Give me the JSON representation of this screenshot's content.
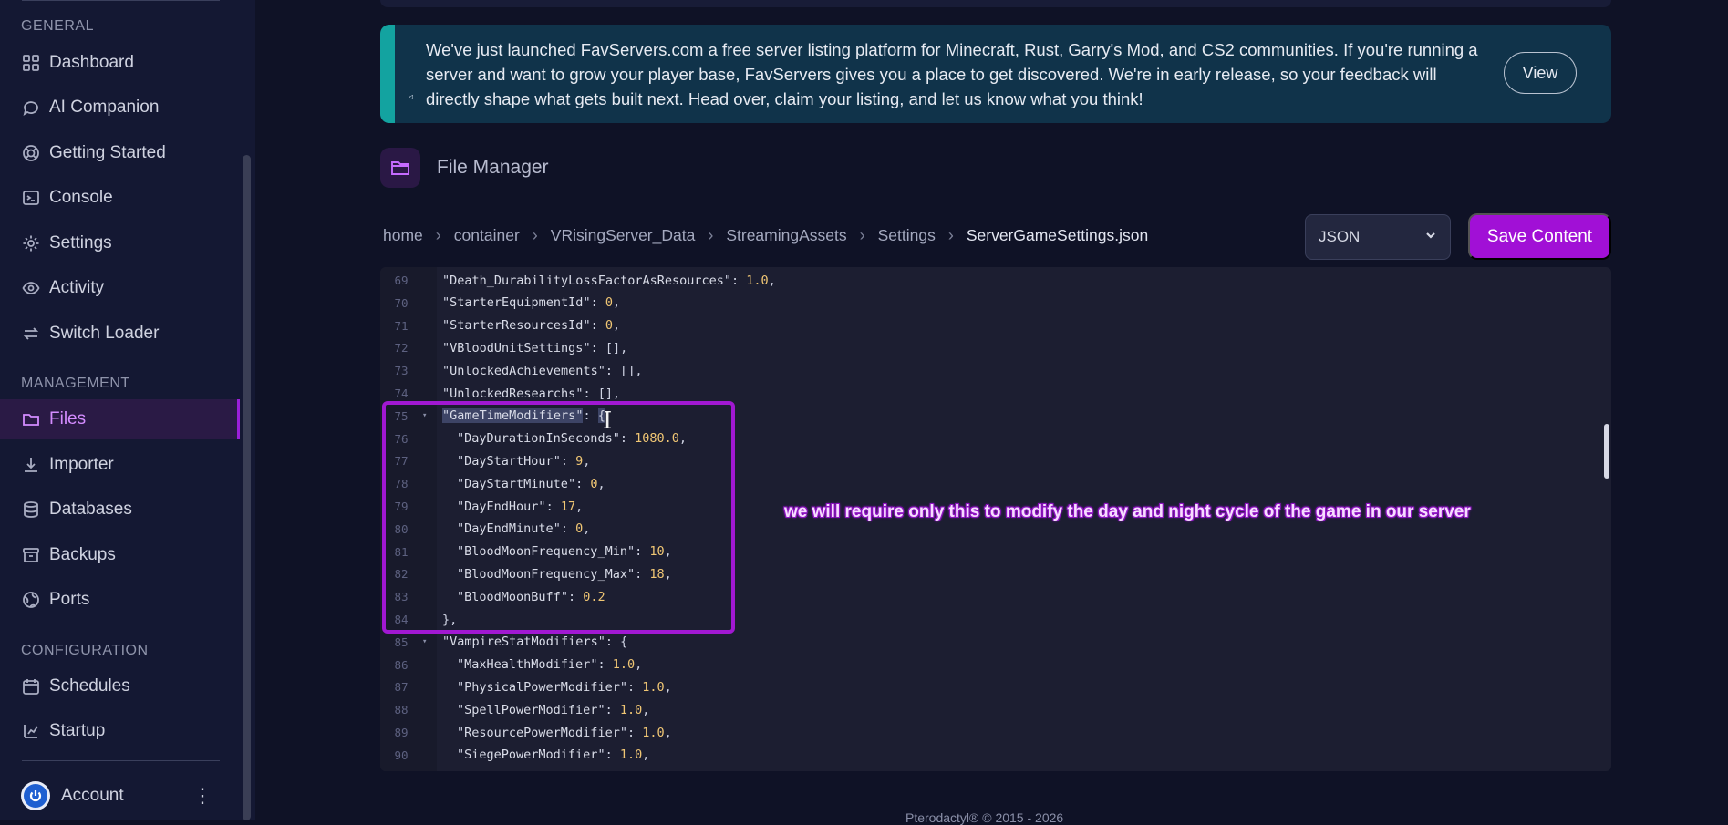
{
  "sidebar": {
    "sections": [
      {
        "label": "GENERAL",
        "items": [
          {
            "label": "Dashboard",
            "icon": "dashboard-icon"
          },
          {
            "label": "AI Companion",
            "icon": "chat-icon"
          },
          {
            "label": "Getting Started",
            "icon": "lifebuoy-icon"
          },
          {
            "label": "Console",
            "icon": "terminal-icon"
          },
          {
            "label": "Settings",
            "icon": "gear-icon"
          },
          {
            "label": "Activity",
            "icon": "eye-icon"
          },
          {
            "label": "Switch Loader",
            "icon": "swap-icon"
          }
        ]
      },
      {
        "label": "MANAGEMENT",
        "items": [
          {
            "label": "Files",
            "icon": "folder-icon",
            "active": true
          },
          {
            "label": "Importer",
            "icon": "download-icon"
          },
          {
            "label": "Databases",
            "icon": "database-icon"
          },
          {
            "label": "Backups",
            "icon": "archive-icon"
          },
          {
            "label": "Ports",
            "icon": "globe-icon"
          }
        ]
      },
      {
        "label": "CONFIGURATION",
        "items": [
          {
            "label": "Schedules",
            "icon": "calendar-icon"
          },
          {
            "label": "Startup",
            "icon": "startup-icon"
          }
        ]
      }
    ],
    "account": {
      "label": "Account"
    }
  },
  "banner": {
    "text": "We've just launched FavServers.com a free server listing platform for Minecraft, Rust, Garry's Mod, and CS2 communities. If you're running a server and want to grow your player base, FavServers gives you a place to get discovered. We're in early release, so your feedback will directly shape what gets built next. Head over, claim your listing, and let us know what you think!",
    "button": "View"
  },
  "file_manager": {
    "title": "File Manager",
    "breadcrumb": [
      "home",
      "container",
      "VRisingServer_Data",
      "StreamingAssets",
      "Settings",
      "ServerGameSettings.json"
    ],
    "mode": "JSON",
    "save_label": "Save Content"
  },
  "editor": {
    "lines": [
      {
        "n": "69",
        "indent": 1,
        "key": "Death_DurabilityLossFactorAsResources",
        "val": "1.0",
        "tail": ","
      },
      {
        "n": "70",
        "indent": 1,
        "key": "StarterEquipmentId",
        "val": "0",
        "tail": ","
      },
      {
        "n": "71",
        "indent": 1,
        "key": "StarterResourcesId",
        "val": "0",
        "tail": ","
      },
      {
        "n": "72",
        "indent": 1,
        "key": "VBloodUnitSettings",
        "val": "",
        "tail": "[],"
      },
      {
        "n": "73",
        "indent": 1,
        "key": "UnlockedAchievements",
        "val": "",
        "tail": "[],"
      },
      {
        "n": "74",
        "indent": 1,
        "key": "UnlockedResearchs",
        "val": "",
        "tail": "[],"
      },
      {
        "n": "75",
        "indent": 1,
        "key": "GameTimeModifiers",
        "val": "",
        "tail": "{",
        "fold": true,
        "selected": true
      },
      {
        "n": "76",
        "indent": 2,
        "key": "DayDurationInSeconds",
        "val": "1080.0",
        "tail": ","
      },
      {
        "n": "77",
        "indent": 2,
        "key": "DayStartHour",
        "val": "9",
        "tail": ","
      },
      {
        "n": "78",
        "indent": 2,
        "key": "DayStartMinute",
        "val": "0",
        "tail": ","
      },
      {
        "n": "79",
        "indent": 2,
        "key": "DayEndHour",
        "val": "17",
        "tail": ","
      },
      {
        "n": "80",
        "indent": 2,
        "key": "DayEndMinute",
        "val": "0",
        "tail": ","
      },
      {
        "n": "81",
        "indent": 2,
        "key": "BloodMoonFrequency_Min",
        "val": "10",
        "tail": ","
      },
      {
        "n": "82",
        "indent": 2,
        "key": "BloodMoonFrequency_Max",
        "val": "18",
        "tail": ","
      },
      {
        "n": "83",
        "indent": 2,
        "key": "BloodMoonBuff",
        "val": "0.2",
        "tail": ""
      },
      {
        "n": "84",
        "indent": 1,
        "key": "",
        "val": "",
        "tail": "},"
      },
      {
        "n": "85",
        "indent": 1,
        "key": "VampireStatModifiers",
        "val": "",
        "tail": "{",
        "fold": true
      },
      {
        "n": "86",
        "indent": 2,
        "key": "MaxHealthModifier",
        "val": "1.0",
        "tail": ","
      },
      {
        "n": "87",
        "indent": 2,
        "key": "PhysicalPowerModifier",
        "val": "1.0",
        "tail": ","
      },
      {
        "n": "88",
        "indent": 2,
        "key": "SpellPowerModifier",
        "val": "1.0",
        "tail": ","
      },
      {
        "n": "89",
        "indent": 2,
        "key": "ResourcePowerModifier",
        "val": "1.0",
        "tail": ","
      },
      {
        "n": "90",
        "indent": 2,
        "key": "SiegePowerModifier",
        "val": "1.0",
        "tail": ","
      }
    ]
  },
  "annotation": {
    "text": "we will require only this to modify the day and night cycle of the game in our server"
  },
  "footer": {
    "text": "Pterodactyl® © 2015 - 2026"
  },
  "colors": {
    "accent": "#a110d6",
    "banner_accent": "#13a3a0",
    "annotation_box": "#a118d2"
  }
}
